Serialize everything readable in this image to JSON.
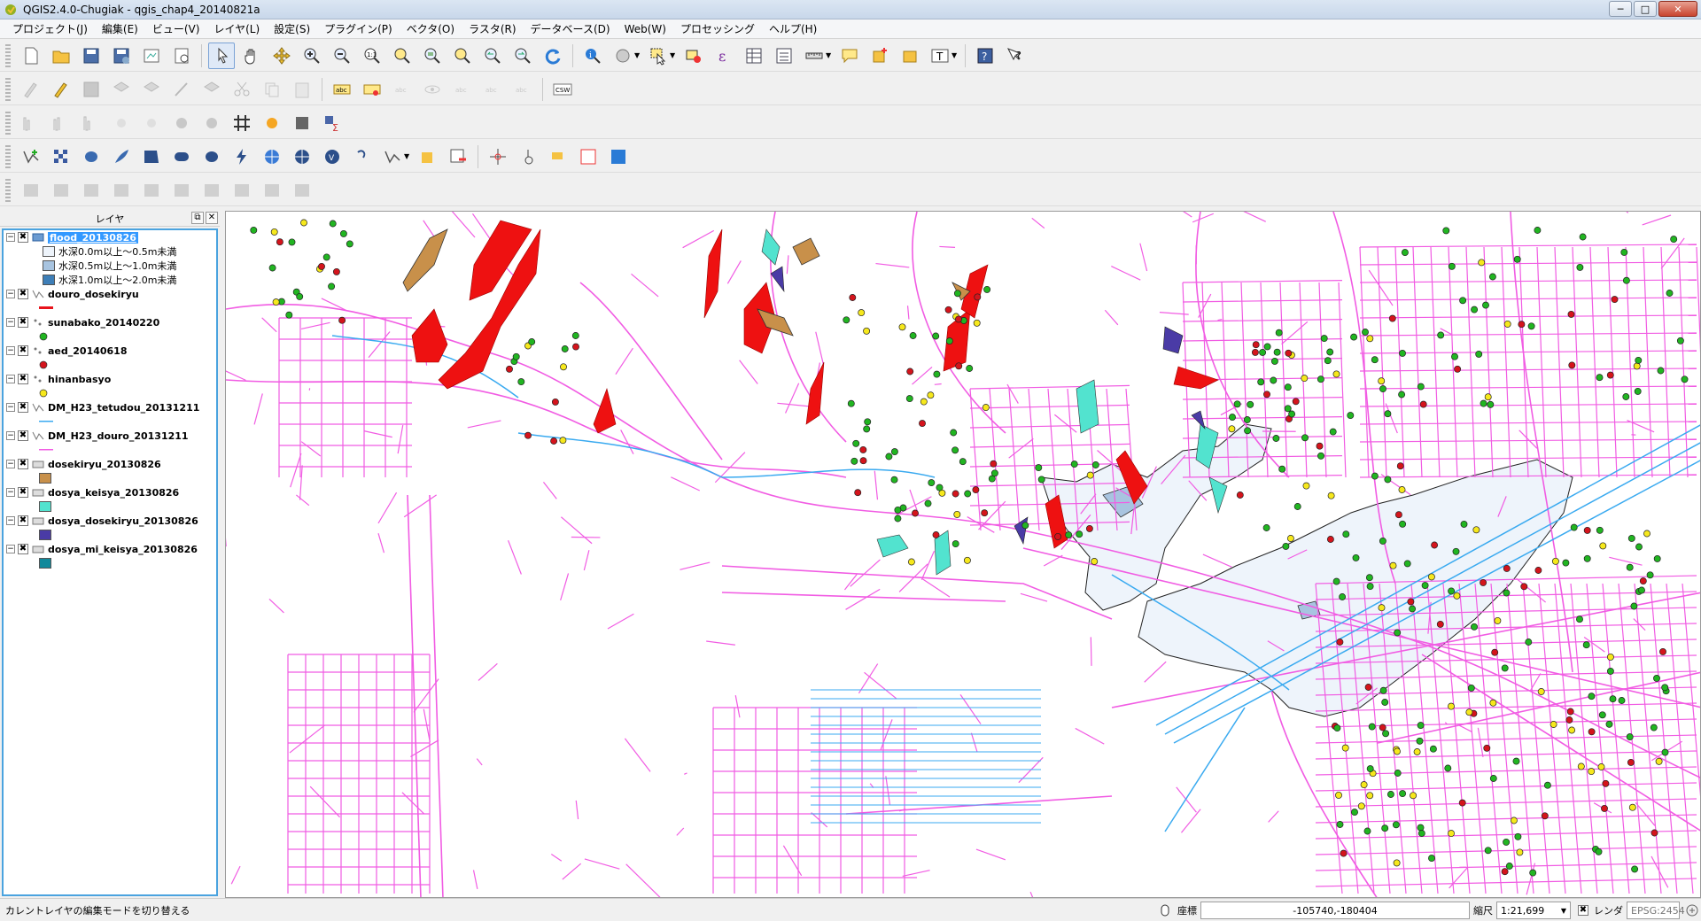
{
  "window": {
    "title": "QGIS2.4.0-Chugiak - qgis_chap4_20140821a",
    "minimize": "─",
    "maximize": "□",
    "close": "✕"
  },
  "menu": [
    "プロジェクト(J)",
    "編集(E)",
    "ビュー(V)",
    "レイヤ(L)",
    "設定(S)",
    "プラグイン(P)",
    "ベクタ(O)",
    "ラスタ(R)",
    "データベース(D)",
    "Web(W)",
    "プロセッシング",
    "ヘルプ(H)"
  ],
  "toolbars": {
    "row1_icons": [
      "new-project-icon",
      "open-project-icon",
      "save-project-icon",
      "save-as-icon",
      "print-composer-icon",
      "composer-manager-icon",
      "touch-zoom-icon",
      "pan-icon",
      "pan-to-selection-icon",
      "zoom-in-icon",
      "zoom-out-icon",
      "zoom-native-icon",
      "zoom-full-icon",
      "zoom-to-layer-icon",
      "zoom-to-selection-icon",
      "zoom-last-icon",
      "zoom-next-icon",
      "refresh-icon",
      "identify-icon",
      "action-icon",
      "select-icon",
      "deselect-icon",
      "expression-select-icon",
      "attribute-table-icon",
      "field-calc-icon",
      "measure-icon",
      "map-tips-icon",
      "new-bookmark-icon",
      "show-bookmarks-icon",
      "text-annotation-icon",
      "help-icon",
      "whats-this-icon"
    ],
    "csw_label": "CSW"
  },
  "layers_panel": {
    "title": "レイヤ",
    "float_btn": "⧉",
    "close_btn": "✕",
    "layers": [
      {
        "name": "flood_20130826",
        "type": "polygon",
        "selected": true,
        "expanded": true,
        "legend": [
          {
            "label": "水深0.0m以上～0.5m未満",
            "color": "#eef4fb"
          },
          {
            "label": "水深0.5m以上～1.0m未満",
            "color": "#a8c4e0"
          },
          {
            "label": "水深1.0m以上～2.0m未満",
            "color": "#3e7fb8"
          }
        ]
      },
      {
        "name": "douro_dosekiryu",
        "type": "line",
        "symbol_color": "#e8141c"
      },
      {
        "name": "sunabako_20140220",
        "type": "point",
        "symbol_color": "#21b521"
      },
      {
        "name": "aed_20140618",
        "type": "point",
        "symbol_color": "#d4141c"
      },
      {
        "name": "hinanbasyo",
        "type": "point",
        "symbol_color": "#f6e81c"
      },
      {
        "name": "DM_H23_tetudou_20131211",
        "type": "line",
        "symbol_color": "#3aaaf0"
      },
      {
        "name": "DM_H23_douro_20131211",
        "type": "line",
        "symbol_color": "#f15ce3"
      },
      {
        "name": "dosekiryu_20130826",
        "type": "polygon",
        "symbol_color": "#c8904a"
      },
      {
        "name": "dosya_keisya_20130826",
        "type": "polygon",
        "symbol_color": "#52e3cf"
      },
      {
        "name": "dosya_dosekiryu_20130826",
        "type": "polygon",
        "symbol_color": "#4a3ba6"
      },
      {
        "name": "dosya_mi_keisya_20130826",
        "type": "polygon",
        "symbol_color": "#11899b"
      }
    ]
  },
  "colors": {
    "roads": "#f15ce3",
    "rail": "#3aaaf0",
    "flood": "#eef4fb",
    "landslide_red": "#ee1111",
    "dosekiryu": "#c8904a",
    "keisya": "#52e3cf",
    "dosya_dosekiryu": "#4a3ba6"
  },
  "status": {
    "message": "カレントレイヤの編集モードを切り替える",
    "coord_label": "座標",
    "coord_value": "-105740,-180404",
    "scale_label": "縮尺",
    "scale_value": "1:21,699",
    "render_label": "レンダ",
    "crs": "EPSG:2454"
  }
}
